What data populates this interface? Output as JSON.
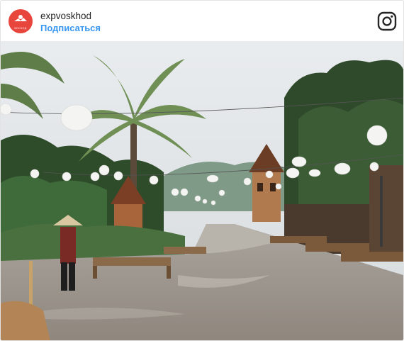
{
  "post": {
    "username": "expvoskhod",
    "subscribe_label": "Подписаться",
    "avatar_text": "ВОСХОД"
  },
  "icons": {
    "platform": "instagram-icon",
    "avatar": "avatar-logo"
  },
  "colors": {
    "avatar_bg": "#e8453c",
    "link": "#3897f0",
    "username": "#262626"
  }
}
